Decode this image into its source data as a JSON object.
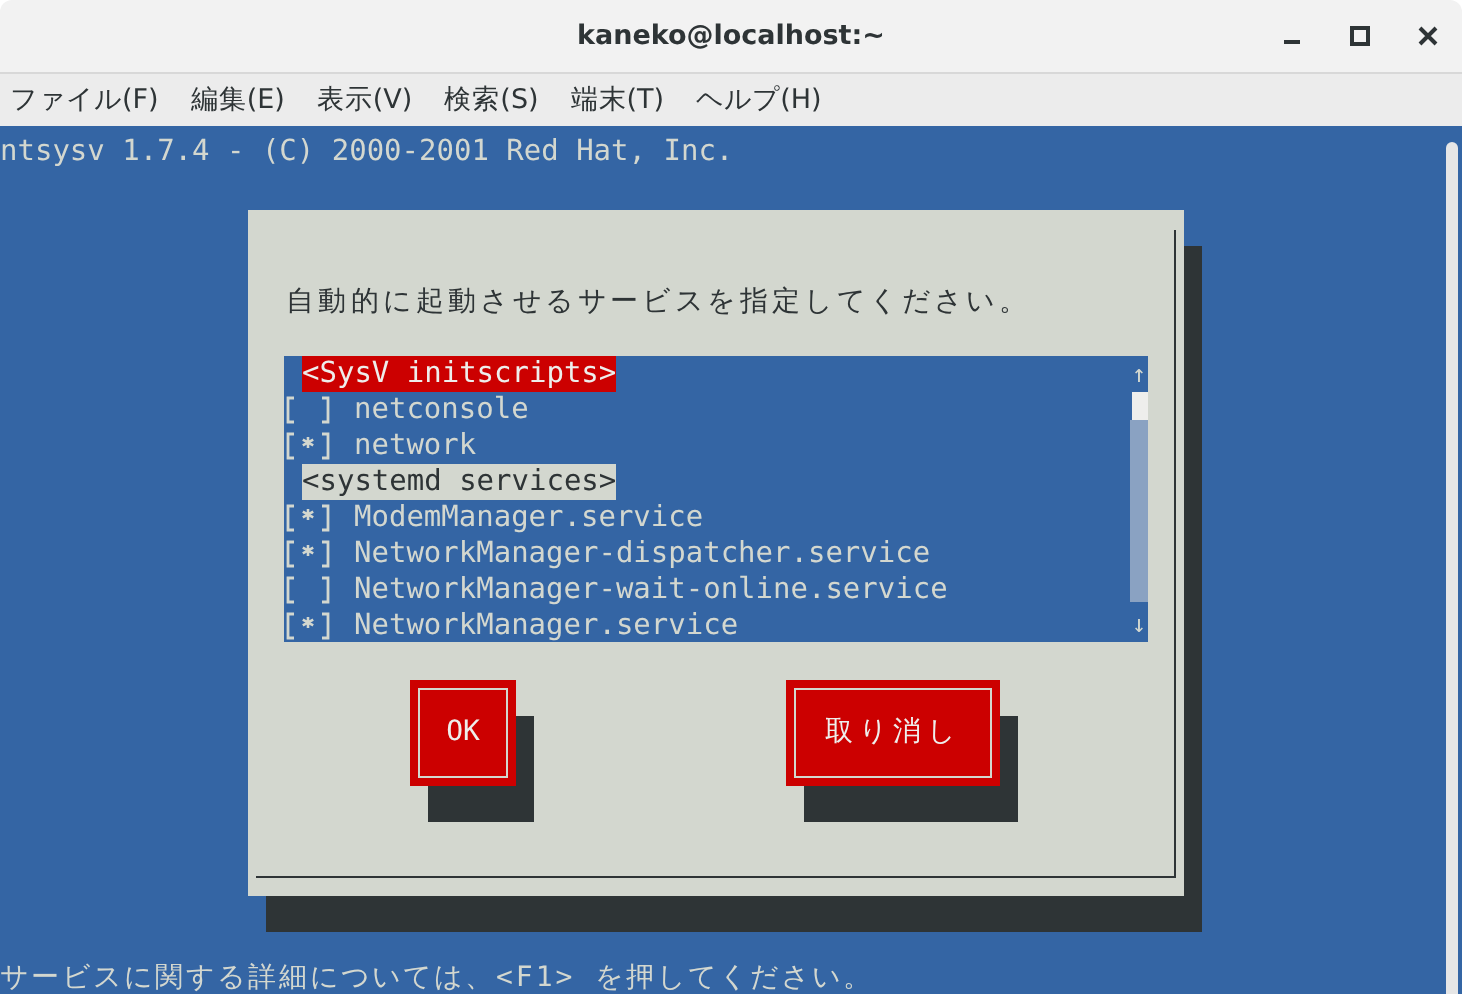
{
  "window": {
    "title": "kaneko@localhost:~"
  },
  "menu": [
    "ファイル(F)",
    "編集(E)",
    "表示(V)",
    "検索(S)",
    "端末(T)",
    "ヘルプ(H)"
  ],
  "terminal": {
    "header_line": "ntsysv 1.7.4 - (C) 2000-2001 Red Hat, Inc.",
    "footer_line": "サービスに関する詳細については、<F1> を押してください。"
  },
  "dialog": {
    "prompt": "自動的に起動させるサービスを指定してください。",
    "list": [
      {
        "kind": "header",
        "label": "<SysV initscripts>",
        "selected": true
      },
      {
        "kind": "service",
        "label": "netconsole",
        "checked": false
      },
      {
        "kind": "service",
        "label": "network",
        "checked": true
      },
      {
        "kind": "header",
        "label": "<systemd services>",
        "selected": false
      },
      {
        "kind": "service",
        "label": "ModemManager.service",
        "checked": true
      },
      {
        "kind": "service",
        "label": "NetworkManager-dispatcher.service",
        "checked": true
      },
      {
        "kind": "service",
        "label": "NetworkManager-wait-online.service",
        "checked": false
      },
      {
        "kind": "service",
        "label": "NetworkManager.service",
        "checked": true
      }
    ],
    "scroll_up": "↑",
    "scroll_down": "↓",
    "buttons": [
      "OK",
      "取り消し"
    ]
  }
}
